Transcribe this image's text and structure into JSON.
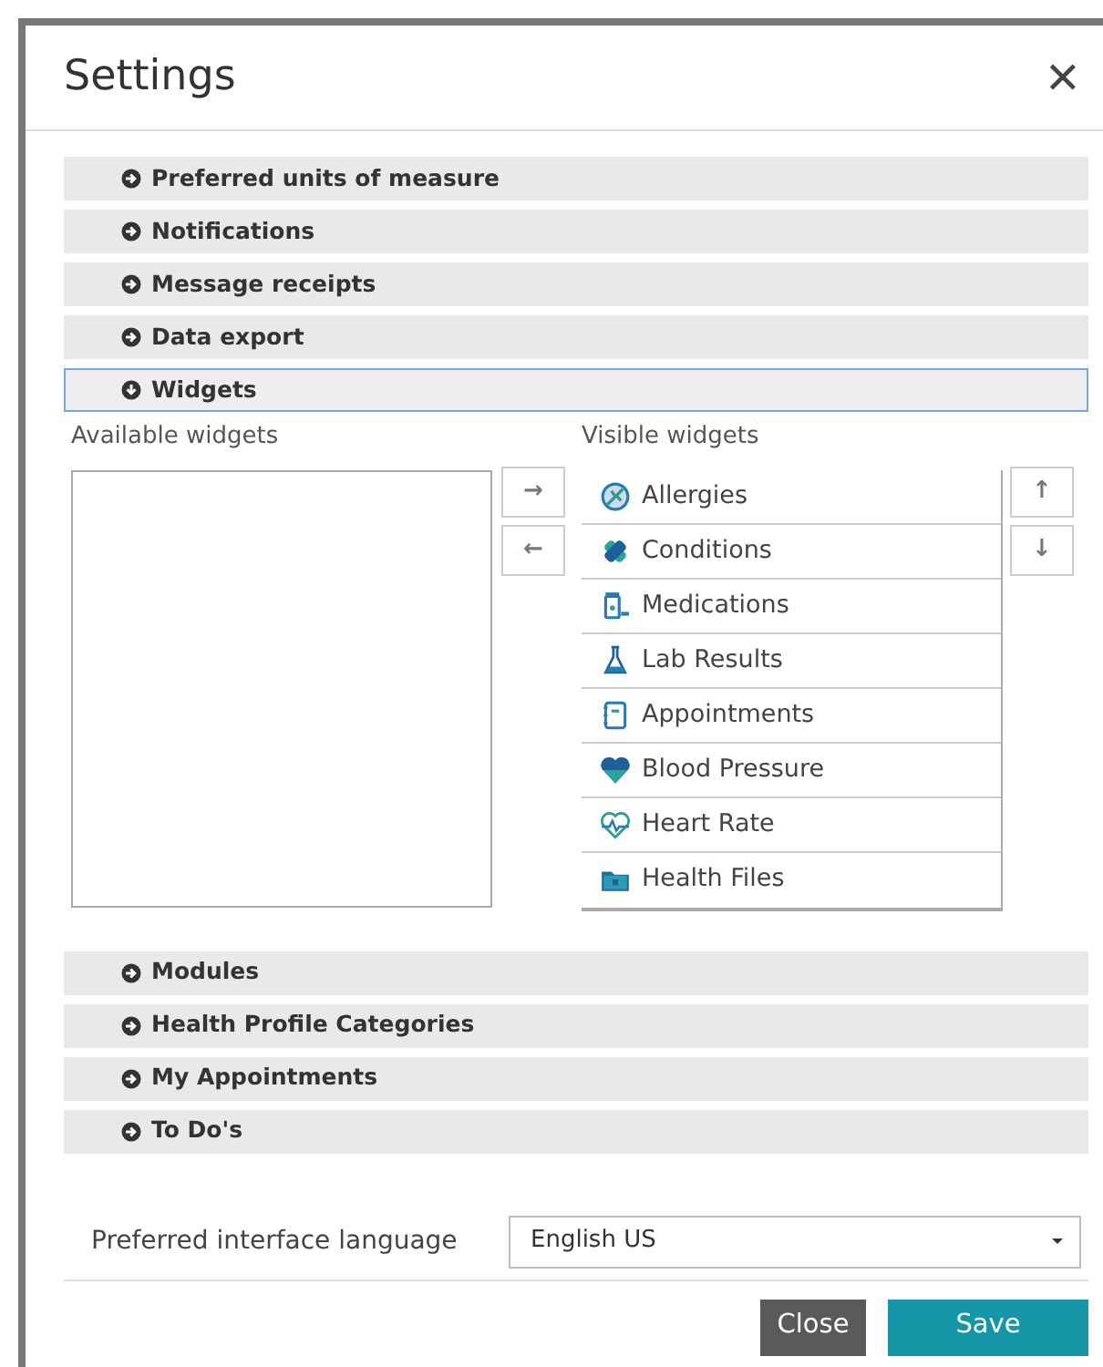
{
  "dialog": {
    "title": "Settings",
    "close": "✕"
  },
  "sections": [
    {
      "title": "Preferred units of measure",
      "expanded": false
    },
    {
      "title": "Notifications",
      "expanded": false
    },
    {
      "title": "Message receipts",
      "expanded": false
    },
    {
      "title": "Data export",
      "expanded": false
    },
    {
      "title": "Widgets",
      "expanded": true
    },
    {
      "title": "Modules",
      "expanded": false
    },
    {
      "title": "Health Profile Categories",
      "expanded": false
    },
    {
      "title": "My Appointments",
      "expanded": false
    },
    {
      "title": "To Do's",
      "expanded": false
    }
  ],
  "widgets": {
    "available_label": "Available widgets",
    "visible_label": "Visible widgets",
    "move_buttons": [
      "→",
      "←"
    ],
    "order_buttons": [
      "↑",
      "↓"
    ],
    "visible": [
      {
        "label": "Allergies"
      },
      {
        "label": "Conditions"
      },
      {
        "label": "Medications"
      },
      {
        "label": "Lab Results"
      },
      {
        "label": "Appointments"
      },
      {
        "label": "Blood Pressure"
      },
      {
        "label": "Heart Rate"
      },
      {
        "label": "Health Files"
      }
    ]
  },
  "language": {
    "label": "Preferred interface language",
    "value": "English US"
  },
  "buttons": [
    {
      "label": "Close",
      "kind": "secondary"
    },
    {
      "label": "Save",
      "kind": "primary"
    }
  ]
}
